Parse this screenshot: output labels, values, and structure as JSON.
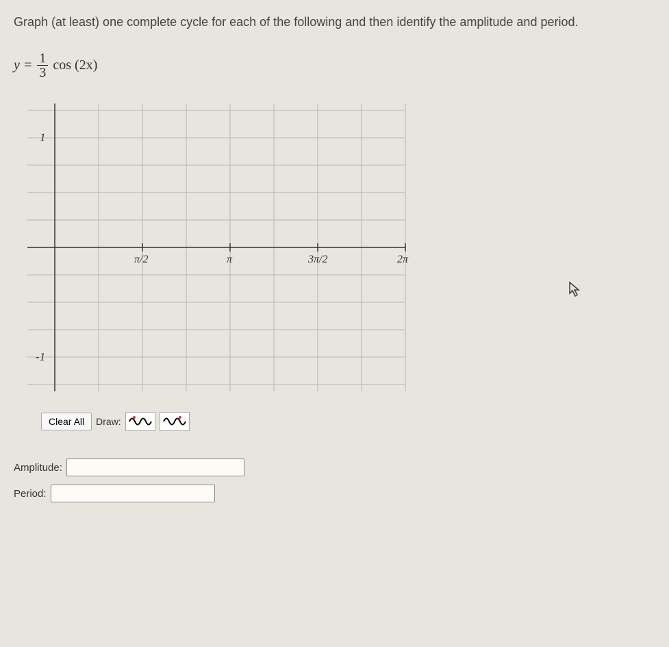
{
  "instructions": "Graph (at least) one complete cycle for each of the following and then identify the amplitude and period.",
  "equation": {
    "lhs": "y =",
    "frac_num": "1",
    "frac_den": "3",
    "rhs": "cos (2x)"
  },
  "chart_data": {
    "type": "line",
    "title": "",
    "xlabel": "",
    "ylabel": "",
    "x_ticks": [
      "π/2",
      "π",
      "3π/2",
      "2π"
    ],
    "y_ticks": [
      "1",
      "-1"
    ],
    "xlim": [
      0,
      6.2832
    ],
    "ylim": [
      -1.2,
      1.2
    ],
    "series": []
  },
  "controls": {
    "clear_label": "Clear All",
    "draw_label": "Draw:"
  },
  "answers": {
    "amplitude_label": "Amplitude:",
    "amplitude_value": "",
    "period_label": "Period:",
    "period_value": ""
  }
}
